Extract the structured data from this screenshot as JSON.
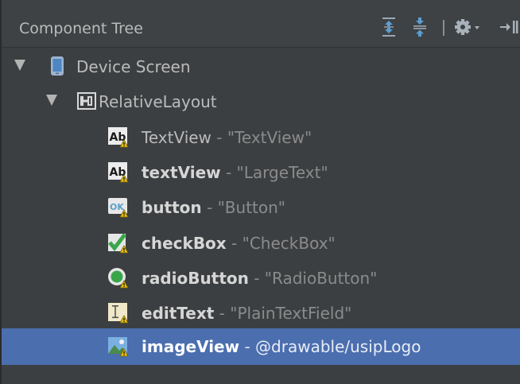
{
  "panel": {
    "title": "Component Tree",
    "toolbar": {
      "expand_icon": "expand-all-icon",
      "collapse_icon": "collapse-all-icon",
      "settings_icon": "gear-icon",
      "hide_icon": "hide-panel-icon"
    }
  },
  "tree": {
    "selected_index": 9,
    "nodes": [
      {
        "label": "Device Screen",
        "icon": "device-icon",
        "expanded": true
      },
      {
        "label": "RelativeLayout",
        "icon": "relative-layout-icon",
        "expanded": true
      },
      {
        "id": "TextView",
        "separator": " - ",
        "value": "\"TextView\"",
        "icon": "textview-icon",
        "warning": true
      },
      {
        "id": "textView",
        "separator": " - ",
        "value": "\"LargeText\"",
        "icon": "textview-icon",
        "warning": true
      },
      {
        "id": "button",
        "separator": " - ",
        "value": "\"Button\"",
        "icon": "button-icon",
        "warning": true,
        "icon_text": "OK"
      },
      {
        "id": "checkBox",
        "separator": " - ",
        "value": "\"CheckBox\"",
        "icon": "checkbox-icon",
        "warning": true
      },
      {
        "id": "radioButton",
        "separator": " - ",
        "value": "\"RadioButton\"",
        "icon": "radiobutton-icon",
        "warning": true
      },
      {
        "id": "editText",
        "separator": " - ",
        "value": "\"PlainTextField\"",
        "icon": "edittext-icon",
        "warning": true
      },
      {
        "id": "imageView",
        "separator": " - ",
        "value": "@drawable/usipLogo",
        "icon": "imageview-icon",
        "warning": true
      }
    ]
  },
  "colors": {
    "background": "#3c3f41",
    "selection": "#4b6eaf",
    "text": "#bbbbbb",
    "value_text": "#8b8b8b",
    "warning": "#e5c00f"
  }
}
